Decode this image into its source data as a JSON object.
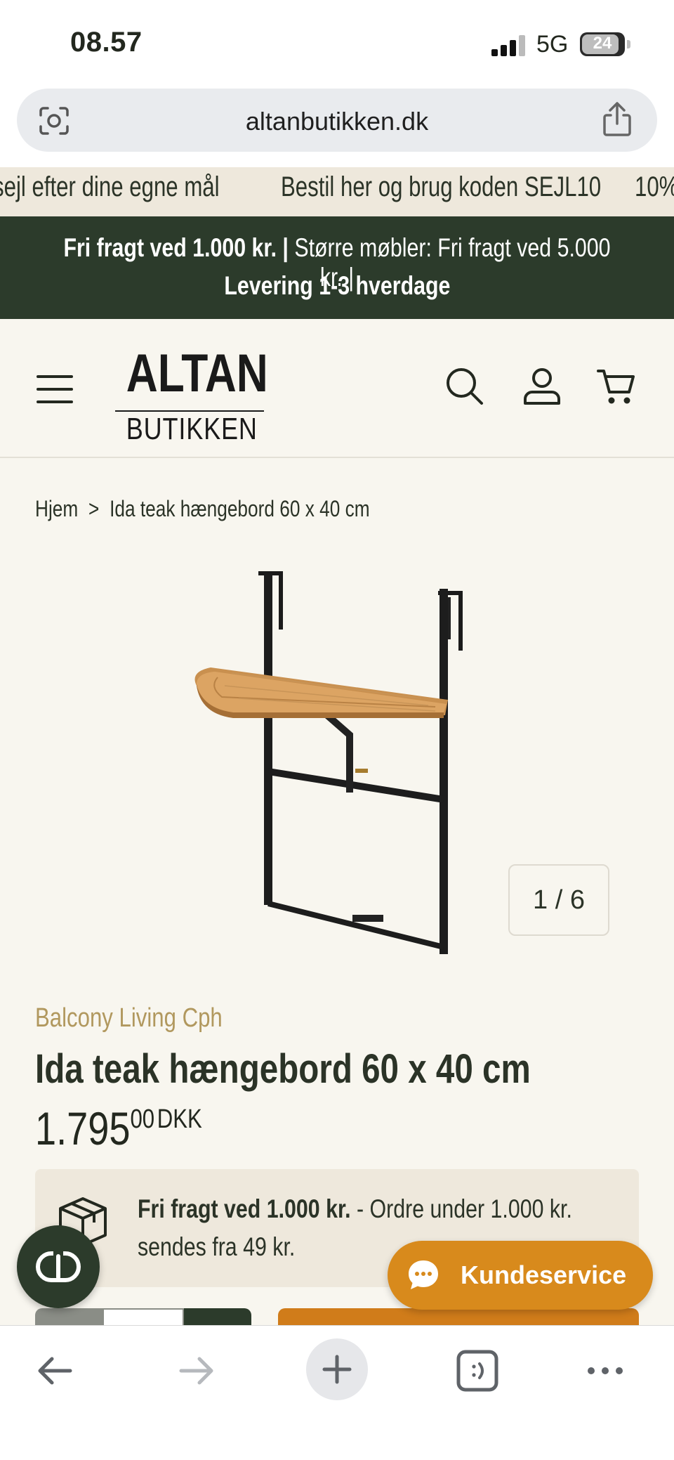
{
  "status_bar": {
    "time": "08.57",
    "network": "5G",
    "battery": "24"
  },
  "browser": {
    "url": "altanbutikken.dk"
  },
  "marquee": {
    "items": [
      "sejl efter dine egne mål",
      "Bestil her og brug koden SEJL10",
      "10%"
    ]
  },
  "shipping_banner": {
    "bold1": "Fri fragt ved 1.000 kr. |",
    "text1": " Større møbler: Fri fragt ved 5.000 kr. |",
    "bold2": "Levering 1-3 hverdage"
  },
  "header": {
    "logo_top": "ALTAN",
    "logo_bottom": "BUTIKKEN"
  },
  "breadcrumb": {
    "home": "Hjem",
    "separator": ">",
    "current": "Ida teak hængebord 60 x 40 cm"
  },
  "gallery": {
    "counter": "1 / 6"
  },
  "product": {
    "brand": "Balcony Living Cph",
    "title": "Ida teak hængebord 60 x 40 cm",
    "price_main": "1.795",
    "price_cents": "00",
    "currency": "DKK"
  },
  "shipping_box": {
    "bold": "Fri fragt ved 1.000 kr.",
    "text": " - Ordre under 1.000 kr.",
    "line2": "sendes fra 49 kr."
  },
  "support": {
    "label": "Kundeservice"
  },
  "colors": {
    "brand_green": "#2c3b2b",
    "accent_orange": "#d88a1c",
    "gold_text": "#b1985e",
    "cream_bg": "#f8f6ef",
    "sand": "#eee8dc"
  },
  "icons": [
    "signal-icon",
    "battery-icon",
    "lens-icon",
    "share-icon",
    "hamburger-icon",
    "search-icon",
    "user-icon",
    "cart-icon",
    "package-icon",
    "chat-bubble-icon",
    "back-icon",
    "forward-icon",
    "plus-icon",
    "tabs-icon",
    "more-icon"
  ]
}
